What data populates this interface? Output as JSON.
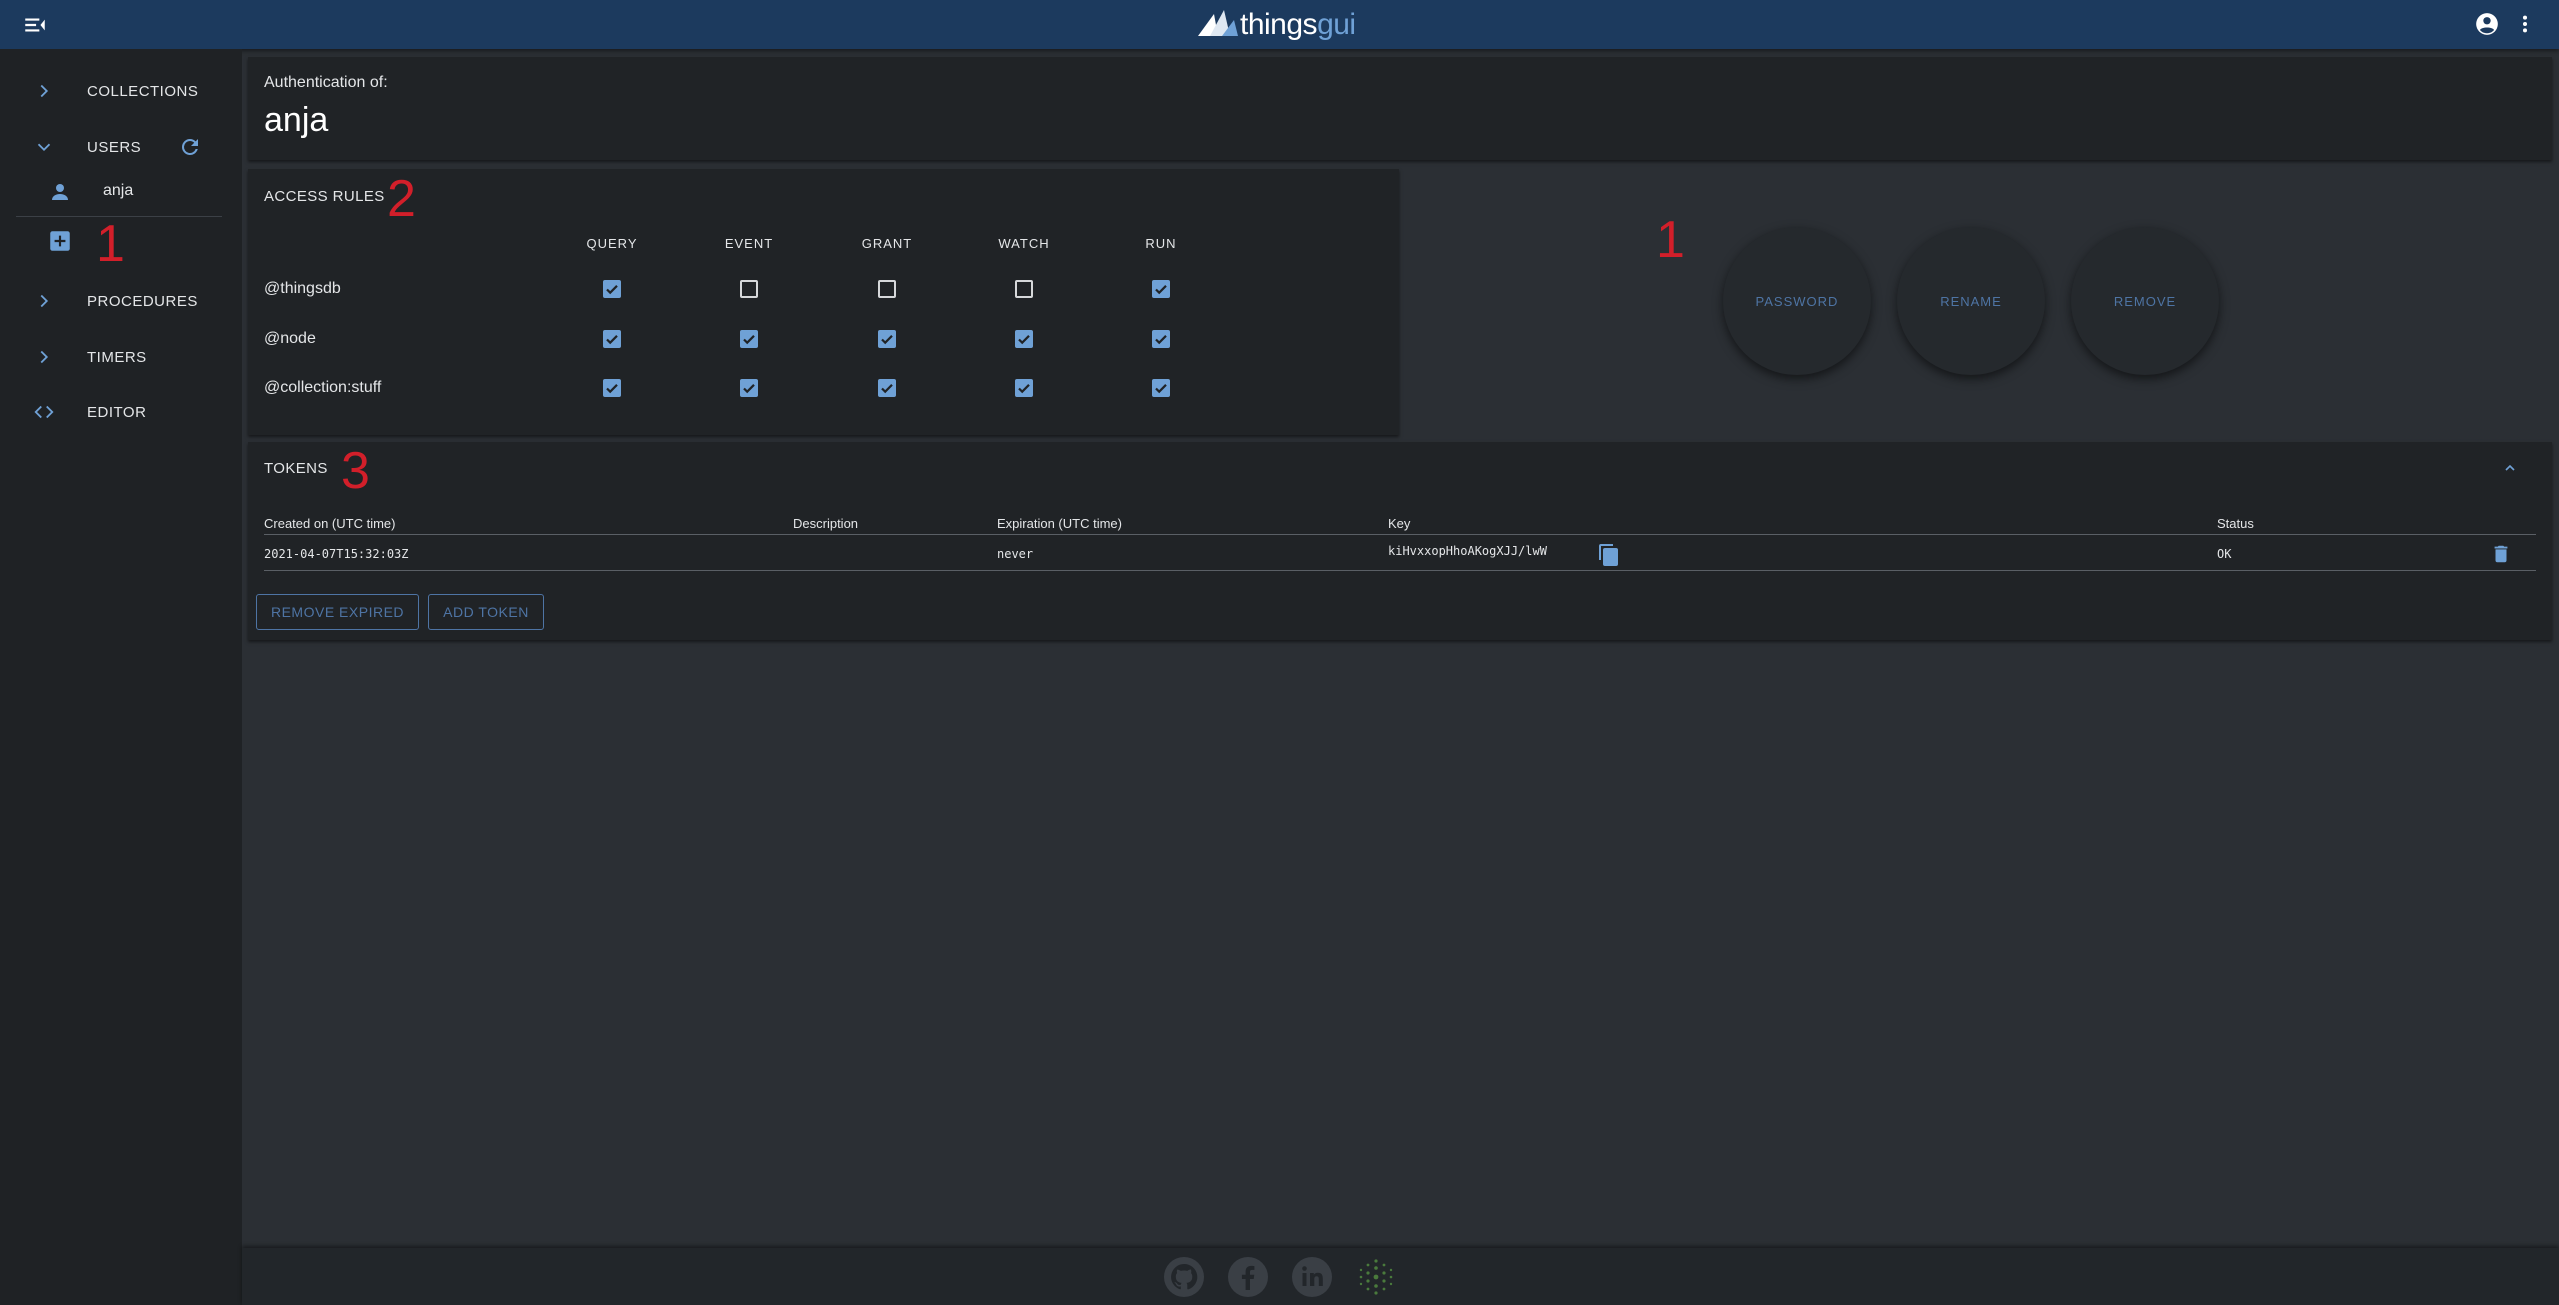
{
  "topbar": {
    "logo_text_main": "things",
    "logo_text_accent": "gui",
    "menu_icon": "menu-collapse-icon",
    "account_icon": "account-circle-icon",
    "more_icon": "dots-vertical-icon"
  },
  "sidebar": {
    "items": [
      {
        "label": "COLLECTIONS",
        "icon": "chevron-right-icon"
      },
      {
        "label": "USERS",
        "icon": "chevron-down-icon"
      },
      {
        "label": "PROCEDURES",
        "icon": "chevron-right-icon"
      },
      {
        "label": "TIMERS",
        "icon": "chevron-right-icon"
      },
      {
        "label": "EDITOR",
        "icon": "code-icon"
      }
    ],
    "users": [
      {
        "label": "anja",
        "icon": "person-icon"
      }
    ],
    "add_user_icon": "add-box-icon",
    "refresh_icon": "refresh-icon"
  },
  "annotations": {
    "mark_users": "1",
    "mark_rules": "2",
    "mark_actions": "1",
    "mark_tokens": "3"
  },
  "auth": {
    "subtitle": "Authentication of:",
    "name": "anja"
  },
  "access_rules": {
    "title": "ACCESS RULES",
    "columns": [
      "QUERY",
      "EVENT",
      "GRANT",
      "WATCH",
      "RUN"
    ],
    "rows": [
      {
        "scope": "@thingsdb",
        "values": [
          true,
          false,
          false,
          false,
          true
        ]
      },
      {
        "scope": "@node",
        "values": [
          true,
          true,
          true,
          true,
          true
        ]
      },
      {
        "scope": "@collection:stuff",
        "values": [
          true,
          true,
          true,
          true,
          true
        ]
      }
    ]
  },
  "actions": {
    "password": "PASSWORD",
    "rename": "RENAME",
    "remove": "REMOVE"
  },
  "tokens": {
    "title": "TOKENS",
    "headers": {
      "created": "Created on (UTC time)",
      "description": "Description",
      "expiration": "Expiration (UTC time)",
      "key": "Key",
      "status": "Status"
    },
    "rows": [
      {
        "created": "2021-04-07T15:32:03Z",
        "description": "",
        "expiration": "never",
        "key": "kiHvxxopHhoAKogXJJ/lwW",
        "status": "OK"
      }
    ],
    "remove_expired_label": "REMOVE EXPIRED",
    "add_token_label": "ADD TOKEN",
    "copy_icon": "content-copy-icon",
    "delete_icon": "delete-icon",
    "collapse_icon": "chevron-up-icon"
  },
  "footer": {
    "icons": [
      "github-icon",
      "facebook-icon",
      "linkedin-icon",
      "thingsdb-dots-icon"
    ]
  },
  "colors": {
    "accent": "#6fa1d6",
    "topbar": "#1c3a5e",
    "annotation": "#d21f2a"
  }
}
